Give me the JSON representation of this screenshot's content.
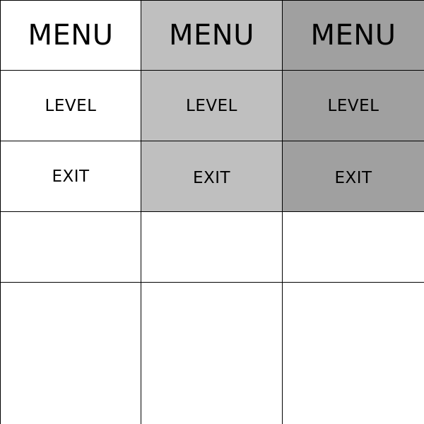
{
  "columns": [
    {
      "menu_label": "MENU",
      "level_label": "LEVEL",
      "exit_label": "EXIT"
    },
    {
      "menu_label": "MENU",
      "level_label": "LEVEL",
      "exit_label": "EXIT"
    },
    {
      "menu_label": "MENU",
      "level_label": "LEVEL",
      "exit_label": "EXIT"
    }
  ],
  "colors": {
    "normal": "#ffffff",
    "hover": "#bfbfbf",
    "pressed": "#a0a0a0",
    "grid_line": "#000000",
    "text": "#000000"
  }
}
